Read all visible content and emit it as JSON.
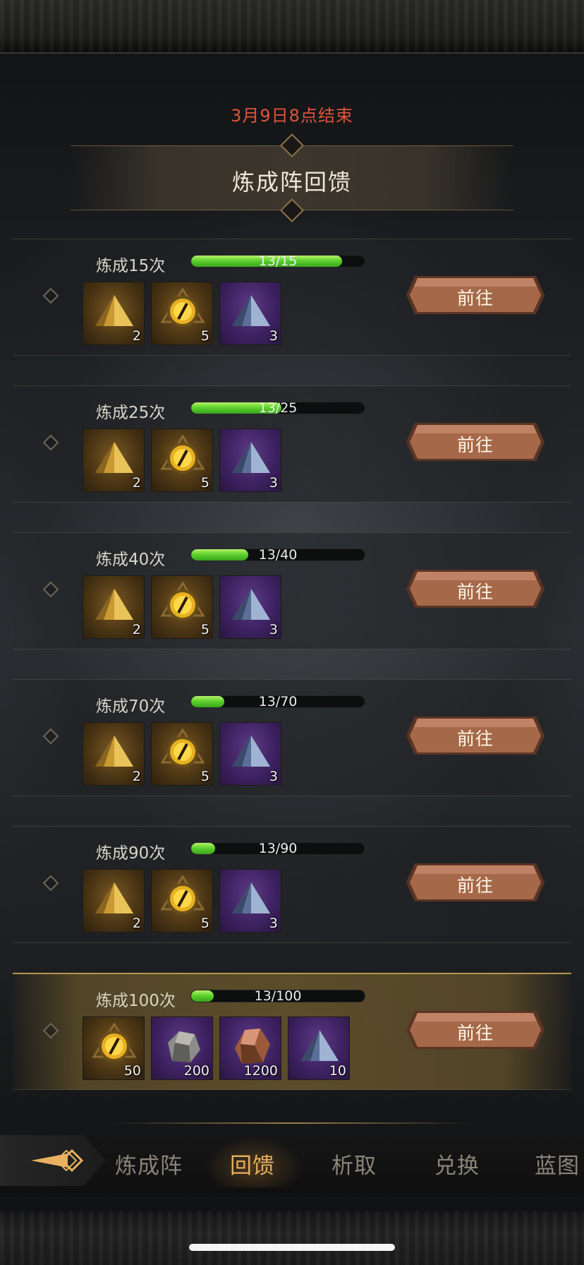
{
  "end_time": "3月9日8点结束",
  "title": "炼成阵回馈",
  "go_label": "前往",
  "colors": {
    "end_time": "#e0543b",
    "bar_fill": "#5fd22e",
    "button": "#a5694a",
    "active_tab": "#e8b060"
  },
  "rewards": [
    {
      "title": "炼成15次",
      "progress_text": "13/15",
      "progress": 0.867,
      "items": [
        {
          "icon": "gold-pyramid-icon",
          "count": "2",
          "rarity": "gold"
        },
        {
          "icon": "golden-eye-icon",
          "count": "5",
          "rarity": "gold"
        },
        {
          "icon": "blue-crystal-pyramid-icon",
          "count": "3",
          "rarity": "purple"
        }
      ]
    },
    {
      "title": "炼成25次",
      "progress_text": "13/25",
      "progress": 0.52,
      "items": [
        {
          "icon": "gold-pyramid-icon",
          "count": "2",
          "rarity": "gold"
        },
        {
          "icon": "golden-eye-icon",
          "count": "5",
          "rarity": "gold"
        },
        {
          "icon": "blue-crystal-pyramid-icon",
          "count": "3",
          "rarity": "purple"
        }
      ]
    },
    {
      "title": "炼成40次",
      "progress_text": "13/40",
      "progress": 0.325,
      "items": [
        {
          "icon": "gold-pyramid-icon",
          "count": "2",
          "rarity": "gold"
        },
        {
          "icon": "golden-eye-icon",
          "count": "5",
          "rarity": "gold"
        },
        {
          "icon": "blue-crystal-pyramid-icon",
          "count": "3",
          "rarity": "purple"
        }
      ]
    },
    {
      "title": "炼成70次",
      "progress_text": "13/70",
      "progress": 0.186,
      "items": [
        {
          "icon": "gold-pyramid-icon",
          "count": "2",
          "rarity": "gold"
        },
        {
          "icon": "golden-eye-icon",
          "count": "5",
          "rarity": "gold"
        },
        {
          "icon": "blue-crystal-pyramid-icon",
          "count": "3",
          "rarity": "purple"
        }
      ]
    },
    {
      "title": "炼成90次",
      "progress_text": "13/90",
      "progress": 0.144,
      "items": [
        {
          "icon": "gold-pyramid-icon",
          "count": "2",
          "rarity": "gold"
        },
        {
          "icon": "golden-eye-icon",
          "count": "5",
          "rarity": "gold"
        },
        {
          "icon": "blue-crystal-pyramid-icon",
          "count": "3",
          "rarity": "purple"
        }
      ]
    },
    {
      "title": "炼成100次",
      "progress_text": "13/100",
      "progress": 0.13,
      "highlight": true,
      "items": [
        {
          "icon": "golden-eye-icon",
          "count": "50",
          "rarity": "gold"
        },
        {
          "icon": "grey-ore-icon",
          "count": "200",
          "rarity": "purple"
        },
        {
          "icon": "copper-ore-icon",
          "count": "1200",
          "rarity": "purple"
        },
        {
          "icon": "blue-crystal-pyramid-icon",
          "count": "10",
          "rarity": "purple"
        }
      ]
    }
  ],
  "tabs": [
    {
      "label": "炼成阵",
      "active": false
    },
    {
      "label": "回馈",
      "active": true
    },
    {
      "label": "析取",
      "active": false
    },
    {
      "label": "兑换",
      "active": false
    },
    {
      "label": "蓝图",
      "active": false
    }
  ]
}
